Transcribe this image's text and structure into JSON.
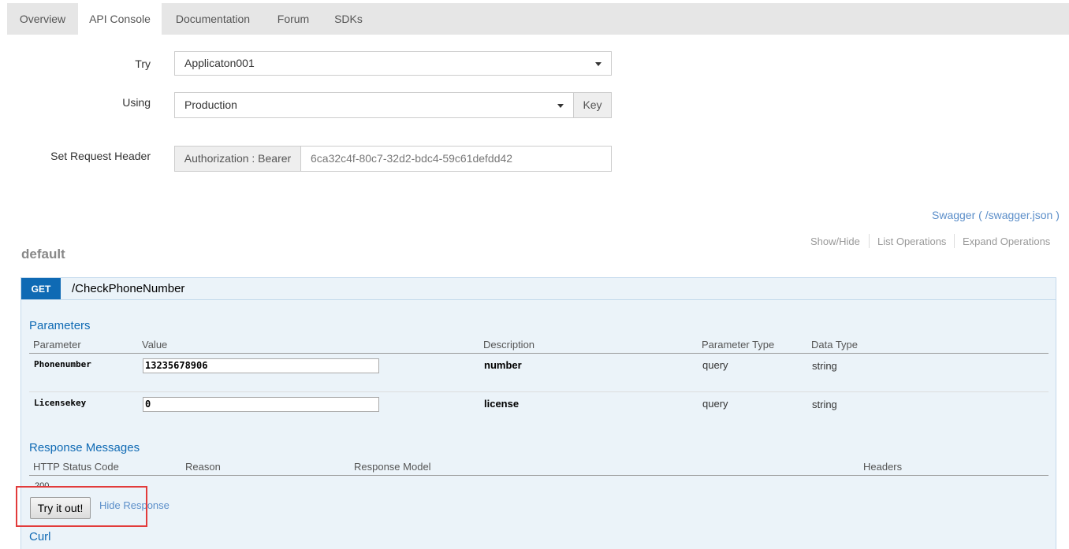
{
  "tabs": [
    {
      "label": "Overview",
      "active": false
    },
    {
      "label": "API Console",
      "active": true
    },
    {
      "label": "Documentation",
      "active": false
    },
    {
      "label": "Forum",
      "active": false
    },
    {
      "label": "SDKs",
      "active": false
    }
  ],
  "form": {
    "try_label": "Try",
    "try_value": "Applicaton001",
    "using_label": "Using",
    "using_value": "Production",
    "key_button": "Key",
    "header_label": "Set Request Header",
    "header_prefix": "Authorization : Bearer",
    "header_token": "6ca32c4f-80c7-32d2-bdc4-59c61defdd42"
  },
  "swagger_link": "Swagger ( /swagger.json )",
  "ops_links": {
    "show_hide": "Show/Hide",
    "list_operations": "List Operations",
    "expand_operations": "Expand Operations"
  },
  "group_title": "default",
  "operation": {
    "method": "GET",
    "path": "/CheckPhoneNumber",
    "method_color": "#0f6ab4",
    "parameters_title": "Parameters",
    "param_headers": {
      "parameter": "Parameter",
      "value": "Value",
      "description": "Description",
      "param_type": "Parameter Type",
      "data_type": "Data Type"
    },
    "params": [
      {
        "name": "Phonenumber",
        "value": "13235678906",
        "description": "number",
        "param_type": "query",
        "data_type": "string"
      },
      {
        "name": "Licensekey",
        "value": "0",
        "description": "license",
        "param_type": "query",
        "data_type": "string"
      }
    ],
    "response_title": "Response Messages",
    "response_headers": {
      "status": "HTTP Status Code",
      "reason": "Reason",
      "model": "Response Model",
      "headers": "Headers"
    },
    "response_rows": [
      {
        "status": "200"
      }
    ],
    "try_button": "Try it out!",
    "hide_response": "Hide Response",
    "curl_title": "Curl"
  }
}
